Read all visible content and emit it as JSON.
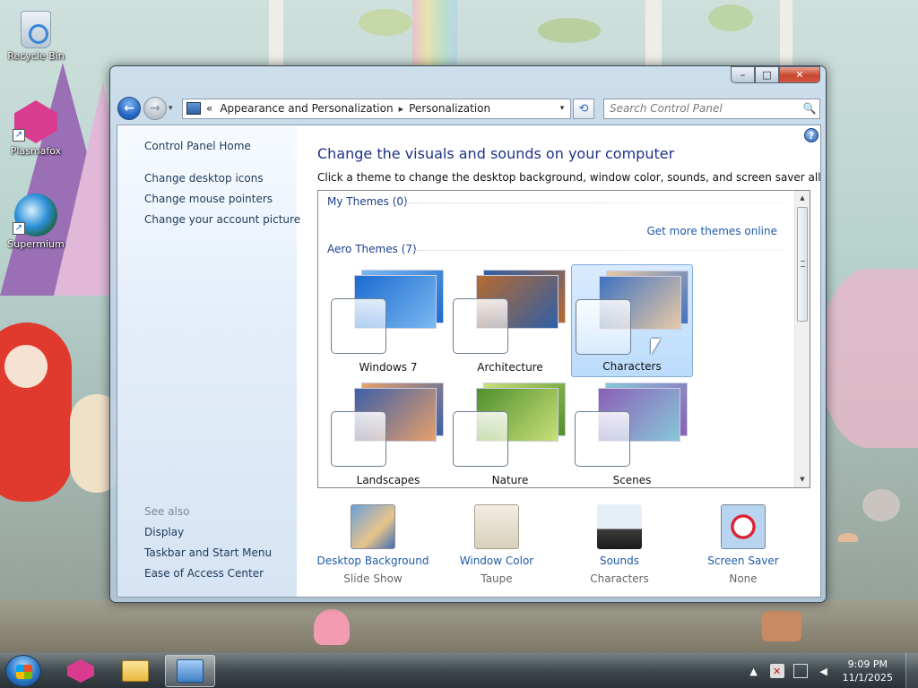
{
  "desktop": {
    "icons": [
      {
        "label": "Recycle Bin",
        "icon": "recycle-bin-icon"
      },
      {
        "label": "Plasmafox",
        "icon": "plasmafox-icon"
      },
      {
        "label": "Supermium",
        "icon": "supermium-icon"
      }
    ]
  },
  "window": {
    "controls": {
      "minimize": "–",
      "maximize": "□",
      "close": "✕"
    },
    "nav": {
      "back": "←",
      "forward": "→",
      "history_dropdown": "▾",
      "breadcrumb_prefix": "«",
      "breadcrumb": [
        "Appearance and Personalization",
        "Personalization"
      ],
      "breadcrumb_separator": "▸",
      "address_dropdown": "▾",
      "refresh": "⟲",
      "search_placeholder": "Search Control Panel",
      "search_icon": "🔍"
    },
    "sidebar": {
      "home": "Control Panel Home",
      "links": [
        "Change desktop icons",
        "Change mouse pointers",
        "Change your account picture"
      ],
      "see_also_title": "See also",
      "see_also": [
        "Display",
        "Taskbar and Start Menu",
        "Ease of Access Center"
      ]
    },
    "main": {
      "help": "?",
      "title": "Change the visuals and sounds on your computer",
      "subtitle": "Click a theme to change the desktop background, window color, sounds, and screen saver all at once.",
      "my_themes_title": "My Themes (0)",
      "get_more_link": "Get more themes online",
      "aero_themes_title": "Aero Themes (7)",
      "themes": [
        {
          "name": "Windows 7",
          "selected": false,
          "colors": [
            "#1b6bd1",
            "#7ab8f0"
          ]
        },
        {
          "name": "Architecture",
          "selected": false,
          "colors": [
            "#b86a2e",
            "#2e5fa6"
          ]
        },
        {
          "name": "Characters",
          "selected": true,
          "colors": [
            "#3f72c0",
            "#e8c9a6"
          ]
        },
        {
          "name": "Landscapes",
          "selected": false,
          "colors": [
            "#3d5fa8",
            "#e5a06a"
          ]
        },
        {
          "name": "Nature",
          "selected": false,
          "colors": [
            "#4f8f2a",
            "#c8e07a"
          ]
        },
        {
          "name": "Scenes",
          "selected": false,
          "colors": [
            "#8a5fb8",
            "#88c7d8"
          ]
        }
      ],
      "bottom": [
        {
          "title": "Desktop Background",
          "value": "Slide Show",
          "icon": "desktop-background-icon"
        },
        {
          "title": "Window Color",
          "value": "Taupe",
          "icon": "window-color-icon",
          "color": "#e2dccb"
        },
        {
          "title": "Sounds",
          "value": "Characters",
          "icon": "sounds-icon"
        },
        {
          "title": "Screen Saver",
          "value": "None",
          "icon": "screen-saver-icon"
        }
      ]
    }
  },
  "taskbar": {
    "time": "9:09 PM",
    "date": "11/1/2025",
    "tray_arrow": "▲",
    "tray_icons": [
      "action-center-icon",
      "network-icon",
      "volume-icon"
    ]
  }
}
